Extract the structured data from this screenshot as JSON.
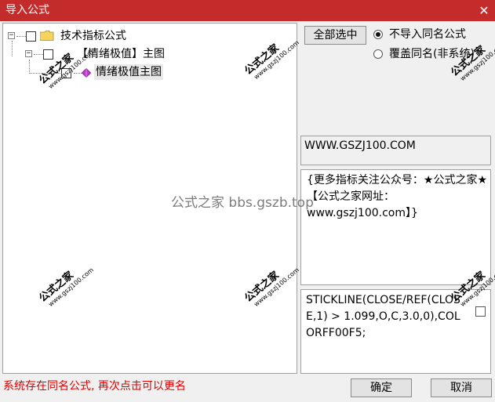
{
  "window": {
    "title": "导入公式",
    "close_glyph": "✕"
  },
  "tree": {
    "root": {
      "expander": "−",
      "label": "技术指标公式"
    },
    "group": {
      "expander": "−",
      "label": "【情绪极值】主图"
    },
    "leaf": {
      "label": "情绪极值主图"
    }
  },
  "options": {
    "select_all_label": "全部选中",
    "radio_skip_label": "不导入同名公式",
    "radio_overwrite_label": "覆盖同名(非系统)",
    "selected": "skip"
  },
  "info": {
    "website": "WWW.GSZJ100.COM",
    "description": "{更多指标关注公众号：★公式之家★ 【公式之家网址：www.gszj100.com】}",
    "formula": "STICKLINE(CLOSE/REF(CLOSE,1) > 1.099,O,C,3.0,0),COLORFF00F5;"
  },
  "footer": {
    "status": "系统存在同名公式, 再次点击可以更名",
    "ok_label": "确定",
    "cancel_label": "取消"
  },
  "watermarks": {
    "center": "公式之家 bbs.gszb.top",
    "stamp_title": "公式之家",
    "stamp_url": "www.gszj100.com"
  },
  "colors": {
    "titlebar": "#c42b2b",
    "status": "#e00000"
  }
}
